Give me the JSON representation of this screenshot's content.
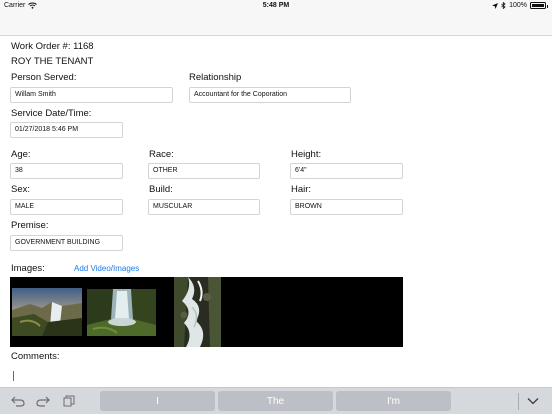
{
  "status_bar": {
    "carrier": "Carrier",
    "time": "5:48 PM",
    "battery": "100%"
  },
  "work_order": {
    "label": "Work Order #:",
    "number": "1168"
  },
  "tenant_name": "ROY THE TENANT",
  "form": {
    "person_served": {
      "label": "Person Served:",
      "value": "Willam Smith"
    },
    "relationship": {
      "label": "Relationship",
      "value": "Accountant for the Coporation"
    },
    "service_date": {
      "label": "Service Date/Time:",
      "value": "01/27/2018 5:46 PM"
    },
    "age": {
      "label": "Age:",
      "value": "38"
    },
    "race": {
      "label": "Race:",
      "value": "OTHER"
    },
    "height": {
      "label": "Height:",
      "value": "6'4\""
    },
    "sex": {
      "label": "Sex:",
      "value": "MALE"
    },
    "build": {
      "label": "Build:",
      "value": "MUSCULAR"
    },
    "hair": {
      "label": "Hair:",
      "value": "BROWN"
    },
    "premise": {
      "label": "Premise:",
      "value": "GOVERNMENT BUILDING"
    }
  },
  "images": {
    "label": "Images:",
    "add_link": "Add Video/Images"
  },
  "comments": {
    "label": "Comments:",
    "value": ""
  },
  "keyboard": {
    "suggestions": [
      "I",
      "The",
      "I'm"
    ],
    "icons": {
      "undo": "undo-icon",
      "redo": "redo-icon",
      "paste": "paste-icon",
      "dismiss": "chevron-down-icon"
    }
  },
  "colors": {
    "accent": "#1a7bf2",
    "keyboard_bar": "#d5d8dd",
    "suggestion_bg": "#bcc0c6"
  }
}
